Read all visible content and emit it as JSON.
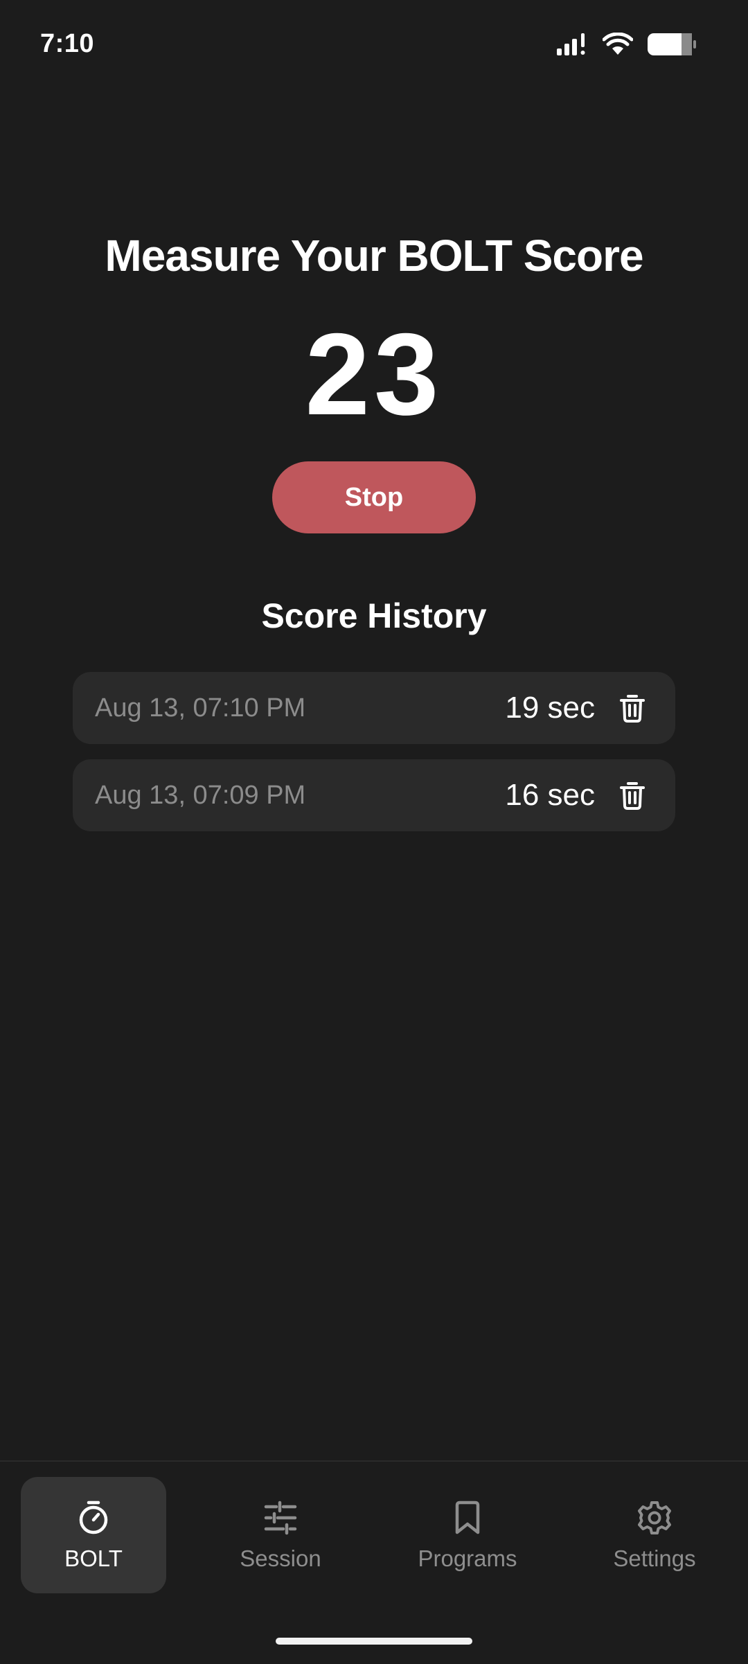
{
  "status_bar": {
    "time": "7:10"
  },
  "main": {
    "title": "Measure Your BOLT Score",
    "score": "23",
    "stop_label": "Stop",
    "history_title": "Score History",
    "history": [
      {
        "date": "Aug 13, 07:10 PM",
        "value": "19 sec"
      },
      {
        "date": "Aug 13, 07:09 PM",
        "value": "16 sec"
      }
    ]
  },
  "nav": {
    "items": [
      {
        "label": "BOLT",
        "icon": "stopwatch-icon",
        "active": true
      },
      {
        "label": "Session",
        "icon": "sliders-icon",
        "active": false
      },
      {
        "label": "Programs",
        "icon": "bookmark-icon",
        "active": false
      },
      {
        "label": "Settings",
        "icon": "gear-icon",
        "active": false
      }
    ]
  },
  "colors": {
    "background": "#1c1c1c",
    "accent": "#bf575c",
    "row_background": "#2a2a2a",
    "active_tab": "#353535"
  }
}
